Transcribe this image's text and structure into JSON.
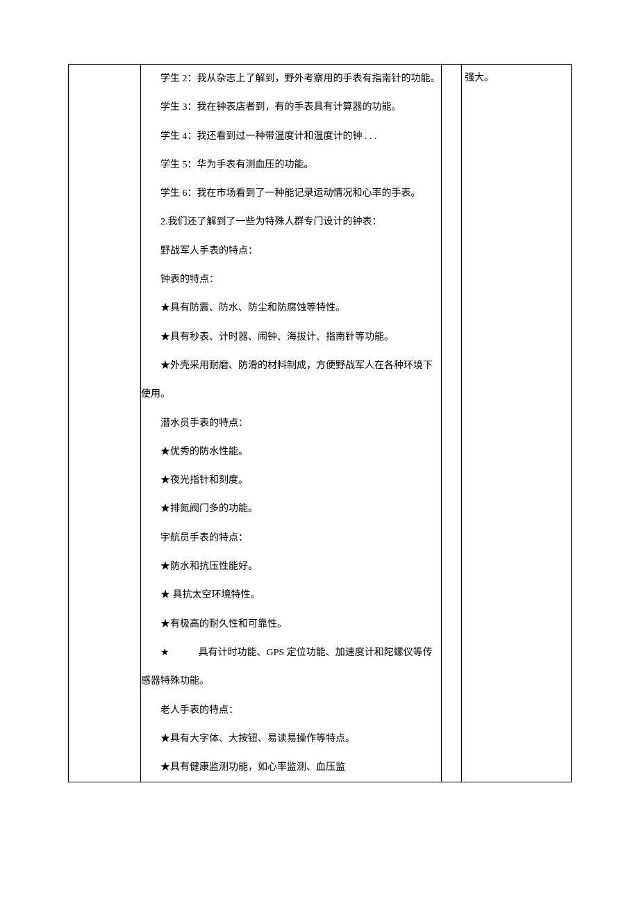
{
  "col2": {
    "p01": "学生 2：我从杂志上了解到，野外考察用的手表有指南针的功能。",
    "p02": "学生 3：我在钟表店者到，有的手表具有计算器的功能。",
    "p03": " 学生 4：我还看到过一种带温度计和温度计的钟 . . .",
    "p04": "学生 5：华为手表有测血压的功能。",
    "p05": "学生 6：我在市场看到了一种能记录运动情况和心率的手表。",
    "p06": "2.我们还了解到了一些为特殊人群专门设计的钟表：",
    "p07": "野战军人手表的特点：",
    "p08": "钟表的特点：",
    "p09": "★具有防震、防水、防尘和防腐蚀等特性。",
    "p10": "★具有秒表、计时器、闹钟、海拔计、指南针等功能。",
    "p11": "★外壳采用耐磨、防滑的材料制成，方便野战军人在各种环境下使用。",
    "p12": "潜水员手表的特点：",
    "p13": "★优秀的防水性能。",
    "p14": "★夜光指针和刻度。",
    "p15": "★排氮阀门多的功能。",
    "p16": "宇航员手表的特点：",
    "p17": "★防水和抗压性能好。",
    "p18": "★ 具抗太空环境特性。",
    "p19": "★有极高的耐久性和可靠性。",
    "p20_star": "★",
    "p20_rest": "具有计时功能、GPS 定位功能、加速度计和陀螺仪等传感器特殊功能。",
    "p21": "老人手表的特点：",
    "p22": "★具有大字体、大按钮、易读易操作等特点。",
    "p23": "★具有健康监测功能，如心率监测、血压监"
  },
  "col4": {
    "text": "强大。"
  }
}
